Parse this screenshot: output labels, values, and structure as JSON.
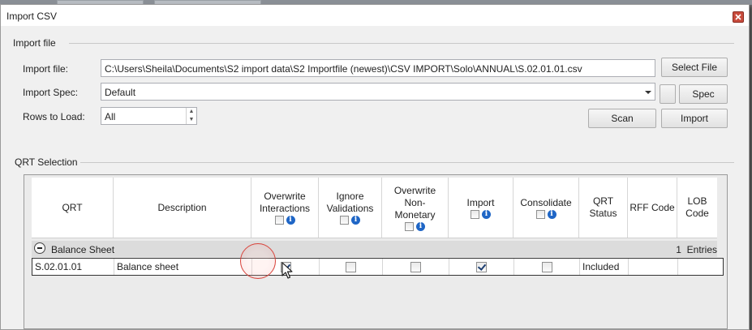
{
  "window": {
    "title": "Import CSV"
  },
  "import_file_group": {
    "label": "Import file",
    "import_file_label": "Import file:",
    "import_file_value": "C:\\Users\\Sheila\\Documents\\S2 import data\\S2 Importfile (newest)\\CSV IMPORT\\Solo\\ANNUAL\\S.02.01.01.csv",
    "import_spec_label": "Import Spec:",
    "import_spec_value": "Default",
    "rows_label": "Rows to Load:",
    "rows_value": "All",
    "select_file_button": "Select File",
    "spec_button": "Spec",
    "scan_button": "Scan",
    "import_button": "Import"
  },
  "qrt_group": {
    "label": "QRT Selection",
    "columns": {
      "qrt": "QRT",
      "description": "Description",
      "overwrite_interactions": [
        "Overwrite",
        "Interactions"
      ],
      "ignore_validations": [
        "Ignore",
        "Validations"
      ],
      "overwrite_non_monetary": [
        "Overwrite",
        "Non-",
        "Monetary"
      ],
      "import": "Import",
      "consolidate": "Consolidate",
      "qrt_status": [
        "QRT",
        "Status"
      ],
      "rff_code": "RFF Code",
      "lob_code": [
        "LOB",
        "Code"
      ]
    },
    "group_row": {
      "label": "Balance Sheet",
      "entries": "1  Entries"
    },
    "rows": [
      {
        "qrt": "S.02.01.01",
        "description": "Balance sheet",
        "overwrite_interactions": true,
        "ignore_validations": false,
        "overwrite_non_monetary": false,
        "import": true,
        "consolidate": false,
        "qrt_status": "Included",
        "rff_code": "",
        "lob_code": ""
      }
    ]
  },
  "icons": {
    "close": "close-icon",
    "info": "info-icon",
    "collapse": "collapse-minus-icon",
    "cursor": "mouse-pointer-icon"
  },
  "colors": {
    "close_button": "#c84b3c",
    "info_icon": "#1f66c6",
    "highlight_ring": "#d9423a"
  }
}
